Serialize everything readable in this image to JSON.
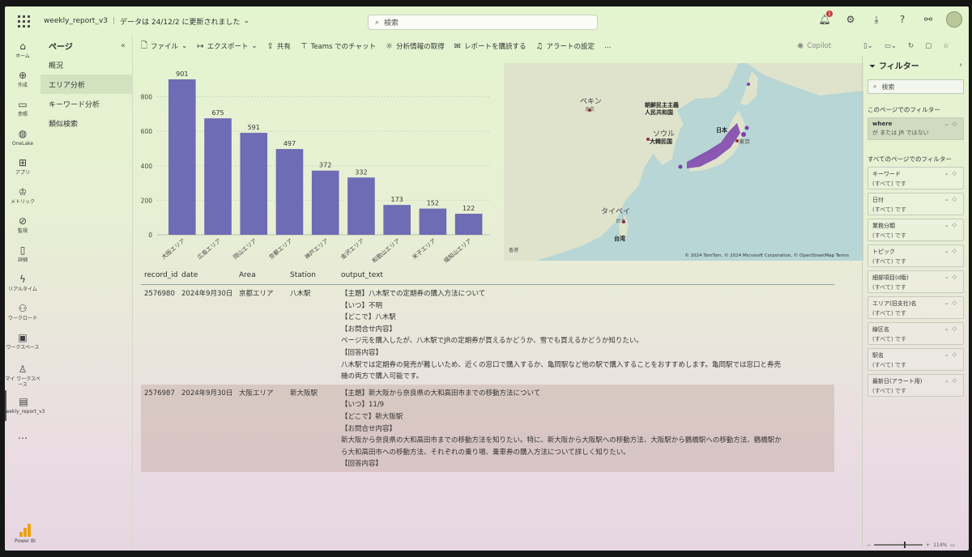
{
  "titlebar": {
    "app_name": "weekly_report_v3",
    "update_status": "データは 24/12/2 に更新されました",
    "search_placeholder": "検索",
    "notification_count": "1"
  },
  "rail": [
    {
      "icon": "home-icon",
      "glyph": "⌂",
      "label": "ホーム"
    },
    {
      "icon": "create-icon",
      "glyph": "⊕",
      "label": "作成"
    },
    {
      "icon": "browse-icon",
      "glyph": "▭",
      "label": "参照"
    },
    {
      "icon": "onelake-icon",
      "glyph": "◍",
      "label": "OneLake"
    },
    {
      "icon": "apps-icon",
      "glyph": "⊞",
      "label": "アプリ"
    },
    {
      "icon": "metrics-icon",
      "glyph": "♔",
      "label": "メトリック"
    },
    {
      "icon": "monitor-icon",
      "glyph": "⊘",
      "label": "監視"
    },
    {
      "icon": "learn-icon",
      "glyph": "▯",
      "label": "詳細"
    },
    {
      "icon": "realtime-icon",
      "glyph": "ϟ",
      "label": "リアルタイム"
    },
    {
      "icon": "workload-icon",
      "glyph": "⚇",
      "label": "ワークロード"
    },
    {
      "icon": "workspace-icon",
      "glyph": "▣",
      "label": "ワークスペース"
    },
    {
      "icon": "my-workspace-icon",
      "glyph": "♙",
      "label": "マイ ワークスペース"
    },
    {
      "icon": "report-icon",
      "glyph": "▤",
      "label": "weekly_report_v3"
    },
    {
      "icon": "more-icon",
      "glyph": "…",
      "label": ""
    }
  ],
  "powerbi_label": "Power BI",
  "pages": {
    "title": "ページ",
    "items": [
      "概況",
      "エリア分析",
      "キーワード分析",
      "類似検索"
    ],
    "active_index": 1
  },
  "toolbar": {
    "file": "ファイル",
    "export": "エクスポート",
    "share": "共有",
    "teams": "Teams でのチャット",
    "insights": "分析情報の取得",
    "subscribe": "レポートを購読する",
    "alerts": "アラートの設定",
    "more": "…",
    "copilot": "Copilot"
  },
  "chart_data": {
    "type": "bar",
    "categories": [
      "大阪エリア",
      "広島エリア",
      "岡山エリア",
      "京都エリア",
      "神戸エリア",
      "金沢エリア",
      "和歌山エリア",
      "米子エリア",
      "福知山エリア"
    ],
    "values": [
      901,
      675,
      591,
      497,
      372,
      332,
      173,
      152,
      122
    ],
    "yticks": [
      0,
      200,
      400,
      600,
      800
    ],
    "ylim": [
      0,
      901
    ],
    "color": "#6e6cb4",
    "title": "",
    "xlabel": "",
    "ylabel": ""
  },
  "map": {
    "labels": {
      "north_korea": "朝鮮民主主義\n人民共和国",
      "south_korea": "大韓民国",
      "japan": "日本",
      "tokyo": "東京",
      "beijing": "ペキン",
      "beijing_sub": "北京",
      "seoul": "ソウル",
      "taipei": "タイペイ",
      "taipei_sub": "台北",
      "taiwan": "台湾",
      "hong_kong": "香港"
    },
    "copyright": "© 2024 TomTom, © 2024 Microsoft Corporation, © OpenStreetMap  Terms"
  },
  "table": {
    "columns": [
      "record_id",
      "date",
      "Area",
      "Station",
      "output_text"
    ],
    "rows": [
      {
        "record_id": "2576980",
        "date": "2024年9月30日",
        "area": "京都エリア",
        "station": "八木駅",
        "text_lines": [
          "【主題】八木駅での定期券の購入方法について",
          "【いつ】不明",
          "【どこで】八木駅",
          "【お問合せ内容】",
          "ページ元を購入したが、八木駅でJRの定期券が買えるかどうか、雪でも買えるかどうか知りたい。",
          "【回答内容】",
          "八木駅では定期券の発売が難しいため、近くの窓口で購入するか、亀岡駅など他の駅で購入することをおすすめします。亀岡駅では窓口と券売",
          "機の両方で購入可能です。"
        ]
      },
      {
        "record_id": "2576987",
        "date": "2024年9月30日",
        "area": "大阪エリア",
        "station": "新大阪駅",
        "text_lines": [
          "【主題】新大阪から奈良県の大和高田市までの移動方法について",
          "【いつ】11/9",
          "【どこで】新大阪駅",
          "【お問合せ内容】",
          "新大阪から奈良県の大和高田市までの移動方法を知りたい。特に、新大阪から大阪駅への移動方法、大阪駅から鶴橋駅への移動方法、鶴橋駅か",
          "ら大和高田市への移動方法、それぞれの乗り場、乗車券の購入方法について詳しく知りたい。",
          "【回答内容】"
        ]
      }
    ]
  },
  "filters": {
    "title": "フィルター",
    "search_placeholder": "検索",
    "page_section": "このページでのフィルター",
    "page_filters": [
      {
        "name": "where",
        "value": "が または JR ではない"
      }
    ],
    "all_section": "すべてのページでのフィルター",
    "all_filters": [
      {
        "name": "キーワード",
        "value": "(すべて) です"
      },
      {
        "name": "日付",
        "value": "(すべて) です"
      },
      {
        "name": "業務分類",
        "value": "(すべて) です"
      },
      {
        "name": "トピック",
        "value": "(すべて) です"
      },
      {
        "name": "細部項目(d版)",
        "value": "(すべて) です"
      },
      {
        "name": "エリア(旧支社)名",
        "value": "(すべて) です"
      },
      {
        "name": "線区名",
        "value": "(すべて) です"
      },
      {
        "name": "駅名",
        "value": "(すべて) です"
      },
      {
        "name": "最新日(アラート用)",
        "value": "(すべて) です"
      }
    ]
  },
  "status": {
    "zoom": "114%",
    "zoom_level": 0.62
  }
}
